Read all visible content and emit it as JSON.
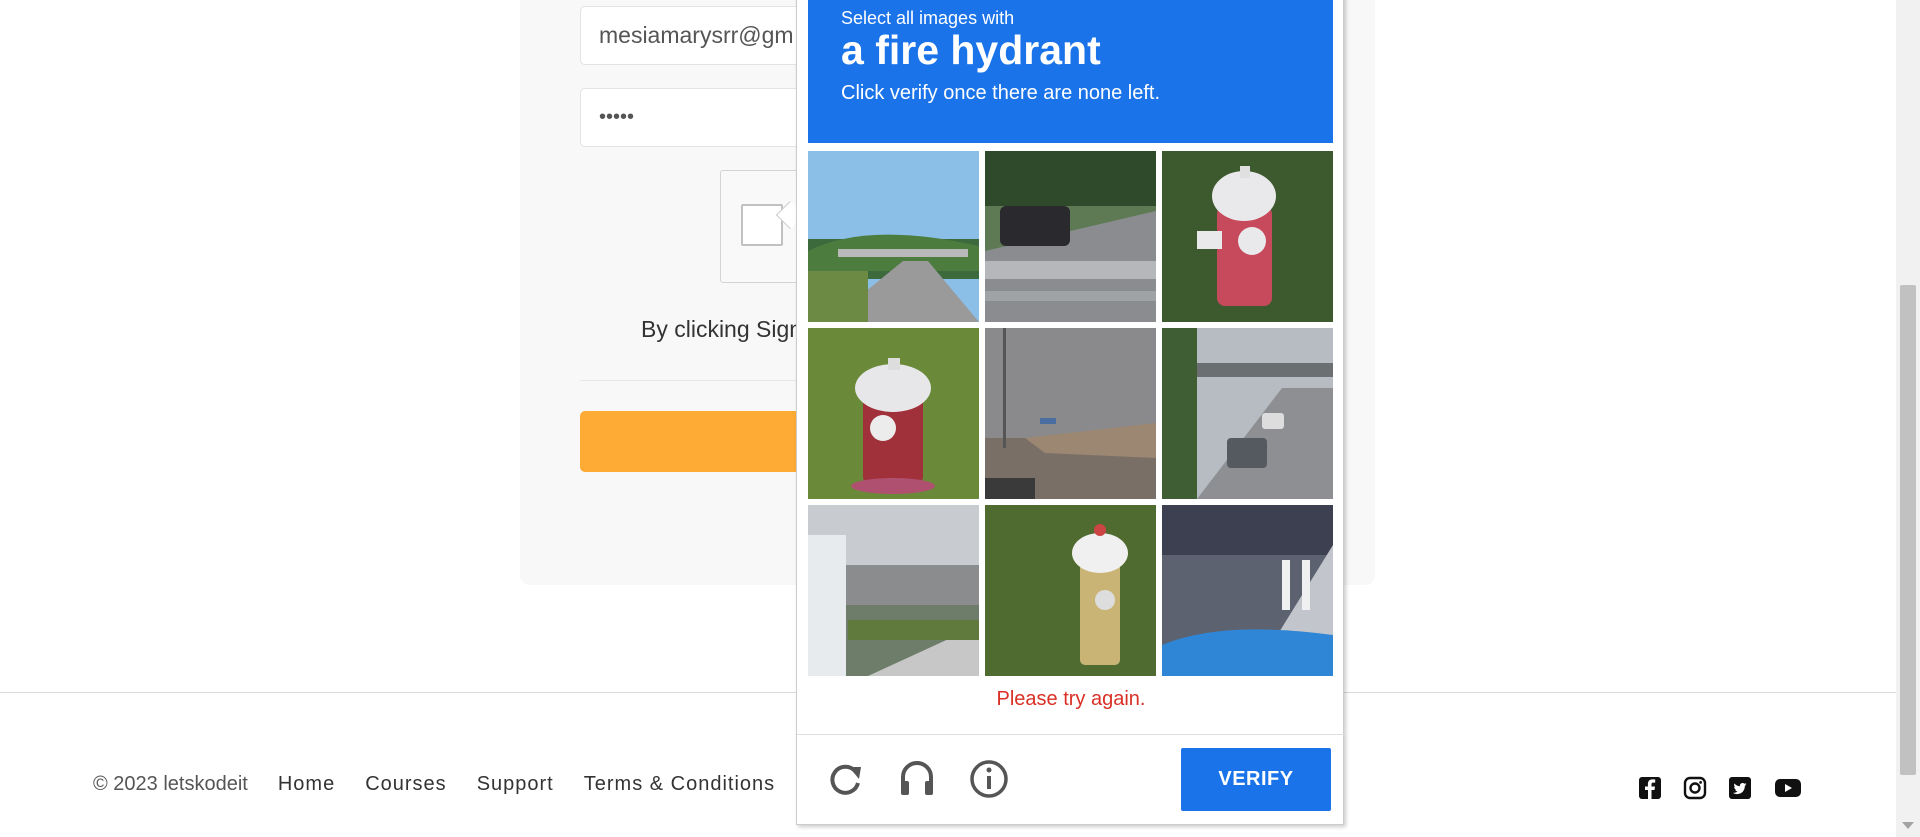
{
  "form": {
    "email_value": "mesiamarysrr@gm",
    "password_value": "•••••",
    "terms_text": "By clicking Sign"
  },
  "footer": {
    "copyright": "© 2023 letskodeit",
    "links": [
      "Home",
      "Courses",
      "Support",
      "Terms & Conditions"
    ],
    "social_icons": [
      "facebook-icon",
      "instagram-icon",
      "twitter-icon",
      "youtube-icon"
    ]
  },
  "challenge": {
    "instruction_small": "Select all images with",
    "instruction_target": "a fire hydrant",
    "instruction_sub": "Click verify once there are none left.",
    "error_message": "Please try again.",
    "verify_label": "VERIFY",
    "tiles": [
      "highway-overpass",
      "car-on-highway",
      "fire-hydrant",
      "fire-hydrant",
      "highway-gray-sky",
      "highway-overpass-cars",
      "bus-sidewalk",
      "fire-hydrant",
      "crosswalk-street"
    ]
  },
  "colors": {
    "accent_blue": "#1a73e8",
    "signup_orange": "#fdab35",
    "error_red": "#d93025"
  }
}
